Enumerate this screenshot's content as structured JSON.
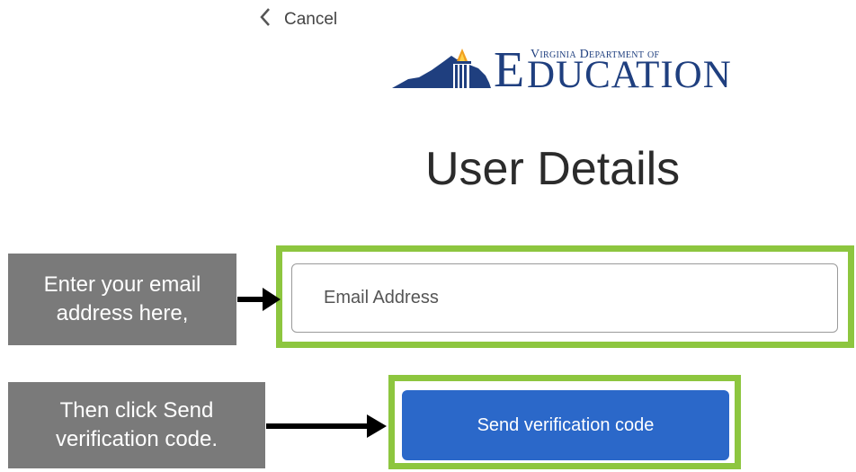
{
  "header": {
    "cancel_label": "Cancel"
  },
  "logo": {
    "line1": "Virginia Department of",
    "e_letter": "E",
    "line2": "DUCATION"
  },
  "main": {
    "title": "User Details",
    "email_placeholder": "Email Address",
    "send_button_label": "Send verification code"
  },
  "annotations": {
    "callout1": [
      "Enter your email",
      "address here,"
    ],
    "callout2": [
      "Then click Send",
      "verification code."
    ],
    "highlight_color": "#8dc63f",
    "callout_color": "#7a7a7a"
  },
  "colors": {
    "button": "#2b68c9",
    "title": "#2b2b2b",
    "logo_blue": "#1f3f7f",
    "logo_flame": "#f0a020"
  }
}
